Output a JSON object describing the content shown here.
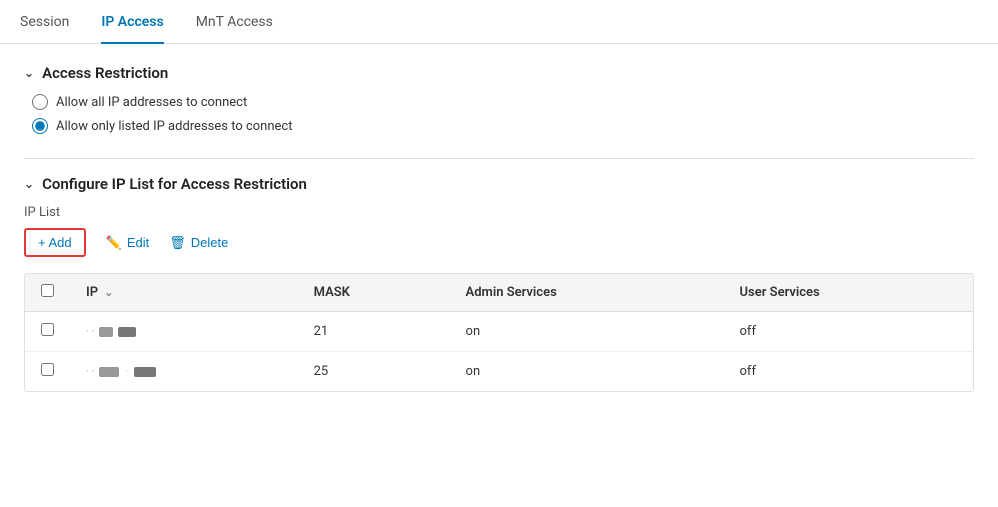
{
  "tabs": [
    {
      "id": "session",
      "label": "Session",
      "active": false
    },
    {
      "id": "ip-access",
      "label": "IP Access",
      "active": true
    },
    {
      "id": "mnt-access",
      "label": "MnT Access",
      "active": false
    }
  ],
  "accessRestriction": {
    "sectionTitle": "Access Restriction",
    "options": [
      {
        "id": "allow-all",
        "label": "Allow all IP addresses to connect",
        "checked": false
      },
      {
        "id": "allow-listed",
        "label": "Allow only listed IP addresses to connect",
        "checked": true
      }
    ]
  },
  "ipListSection": {
    "sectionTitle": "Configure IP List for Access Restriction",
    "listLabel": "IP List",
    "toolbar": {
      "addLabel": "+ Add",
      "editLabel": "Edit",
      "deleteLabel": "Delete"
    },
    "table": {
      "columns": [
        {
          "id": "checkbox",
          "label": ""
        },
        {
          "id": "ip",
          "label": "IP"
        },
        {
          "id": "mask",
          "label": "MASK"
        },
        {
          "id": "admin",
          "label": "Admin Services"
        },
        {
          "id": "user",
          "label": "User Services"
        }
      ],
      "rows": [
        {
          "id": 1,
          "ip": "masked1",
          "mask": "21",
          "admin": "on",
          "user": "off"
        },
        {
          "id": 2,
          "ip": "masked2",
          "mask": "25",
          "admin": "on",
          "user": "off"
        }
      ]
    }
  }
}
